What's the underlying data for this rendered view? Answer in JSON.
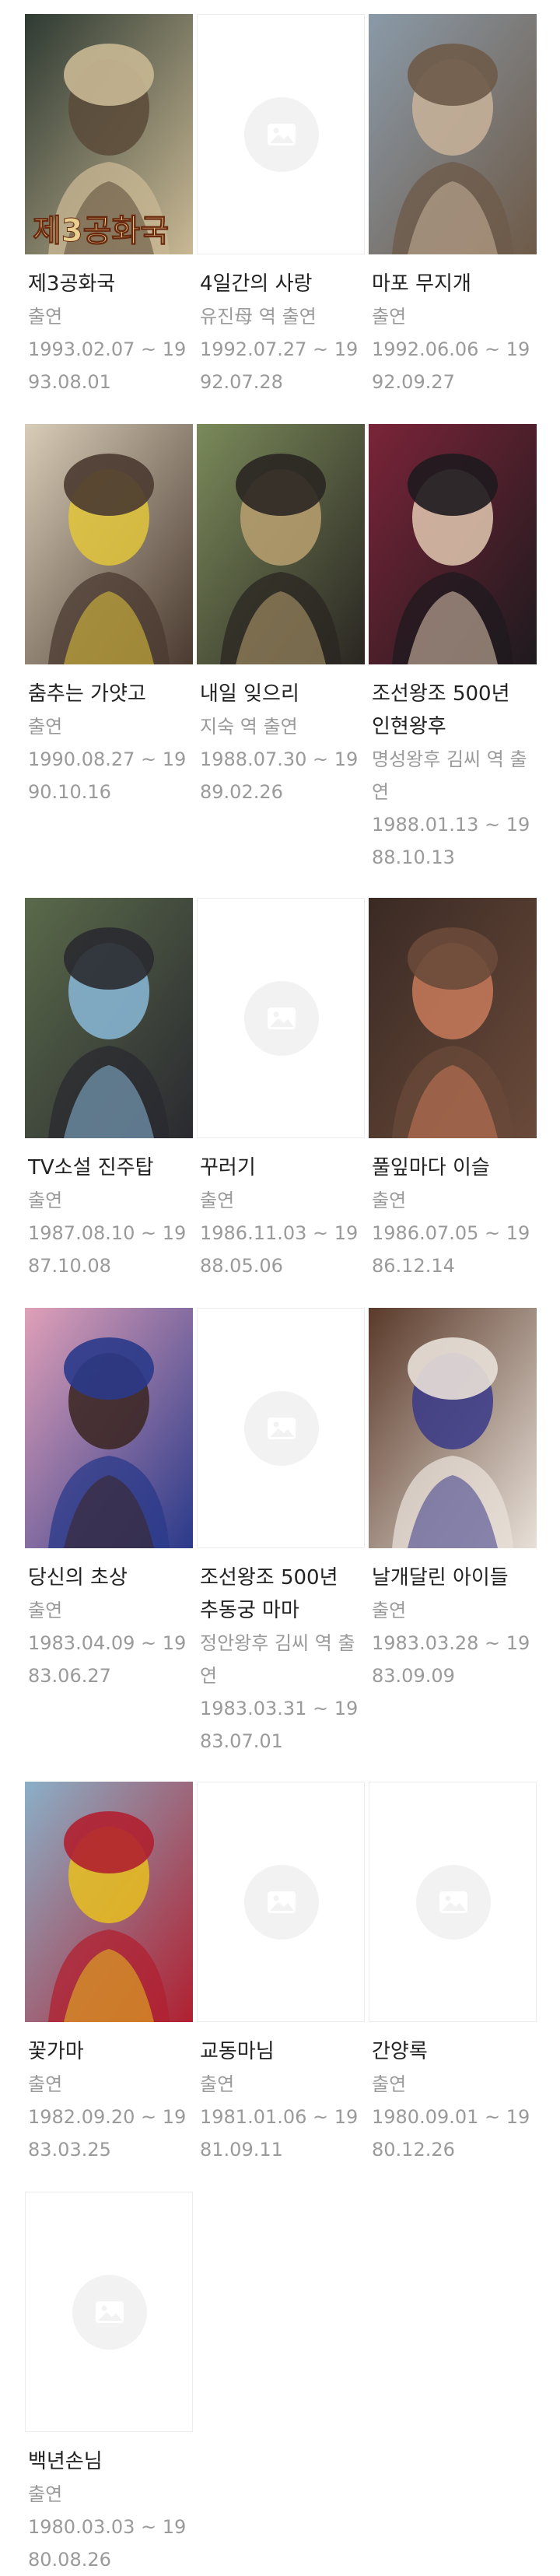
{
  "items": [
    {
      "title": "제3공화국",
      "role": "출연",
      "dates": "1993.02.07 ~ 1993.08.01",
      "poster": "image",
      "poster_text": "제3공화국",
      "palette": [
        "#2e3a32",
        "#5a4a38",
        "#c9b894"
      ]
    },
    {
      "title": "4일간의 사랑",
      "role": "유진母 역 출연",
      "dates": "1992.07.27 ~ 1992.07.28",
      "poster": "placeholder"
    },
    {
      "title": "마포 무지개",
      "role": "출연",
      "dates": "1992.06.06 ~ 1992.09.27",
      "poster": "image",
      "palette": [
        "#8a9aa8",
        "#c9b39a",
        "#6e5a48"
      ]
    },
    {
      "title": "춤추는 가얏고",
      "role": "출연",
      "dates": "1990.08.27 ~ 1990.10.16",
      "poster": "image",
      "palette": [
        "#d8cdb8",
        "#e2c53b",
        "#4a3a30"
      ]
    },
    {
      "title": "내일 잊으리",
      "role": "지숙 역 출연",
      "dates": "1988.07.30 ~ 1989.02.26",
      "poster": "image",
      "palette": [
        "#7a8a5a",
        "#b8a070",
        "#2a2622"
      ]
    },
    {
      "title": "조선왕조 500년 인현왕후",
      "role": "명성왕후 김씨 역 출연",
      "dates": "1988.01.13 ~ 1988.10.13",
      "poster": "image",
      "palette": [
        "#7a2438",
        "#e2c8b0",
        "#1e1a1e"
      ]
    },
    {
      "title": "TV소설 진주탑",
      "role": "출연",
      "dates": "1987.08.10 ~ 1987.10.08",
      "poster": "image",
      "palette": [
        "#5a6a4a",
        "#8ab8d8",
        "#2a2a30"
      ]
    },
    {
      "title": "꾸러기",
      "role": "출연",
      "dates": "1986.11.03 ~ 1988.05.06",
      "poster": "placeholder"
    },
    {
      "title": "풀잎마다 이슬",
      "role": "출연",
      "dates": "1986.07.05 ~ 1986.12.14",
      "poster": "image",
      "palette": [
        "#3a2a24",
        "#c87a5a",
        "#6a4a3a"
      ]
    },
    {
      "title": "당신의 초상",
      "role": "출연",
      "dates": "1983.04.09 ~ 1983.06.27",
      "poster": "image",
      "palette": [
        "#e0a0b8",
        "#3a2420",
        "#2a3a8a"
      ]
    },
    {
      "title": "조선왕조 500년 추동궁 마마",
      "role": "정안왕후 김씨 역 출연",
      "dates": "1983.03.31 ~ 1983.07.01",
      "poster": "placeholder"
    },
    {
      "title": "날개달린 아이들",
      "role": "출연",
      "dates": "1983.03.28 ~ 1983.09.09",
      "poster": "image",
      "palette": [
        "#5a3a2a",
        "#3a3a8a",
        "#e8e0d8"
      ]
    },
    {
      "title": "꽃가마",
      "role": "출연",
      "dates": "1982.09.20 ~ 1983.03.25",
      "poster": "image",
      "palette": [
        "#8ab0c8",
        "#e8c020",
        "#b02030"
      ]
    },
    {
      "title": "교동마님",
      "role": "출연",
      "dates": "1981.01.06 ~ 1981.09.11",
      "poster": "placeholder"
    },
    {
      "title": "간양록",
      "role": "출연",
      "dates": "1980.09.01 ~ 1980.12.26",
      "poster": "placeholder"
    },
    {
      "title": "백년손님",
      "role": "출연",
      "dates": "1980.03.03 ~ 1980.08.26",
      "poster": "placeholder"
    }
  ],
  "icons": {
    "placeholder": "image-placeholder-icon"
  }
}
